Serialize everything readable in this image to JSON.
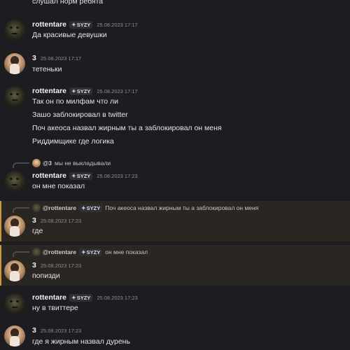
{
  "messages": [
    {
      "text": "слушал норм ребята"
    },
    {
      "author": "rottentare",
      "tag": "SYZY",
      "time": "25.08.2023 17:17",
      "lines": [
        "Да красивые девушки"
      ]
    },
    {
      "author": "3",
      "time": "25.08.2023 17:17",
      "lines": [
        "тетеньки"
      ]
    },
    {
      "author": "rottentare",
      "tag": "SYZY",
      "time": "25.08.2023 17:17",
      "lines": [
        "Так он по милфам что ли",
        "Зашо заблокировал в twitter",
        "Поч акеоса назвал жирным ты а заблокировал он меня",
        "Риддимщике где логика"
      ]
    },
    {
      "reply": {
        "author": "@3",
        "text": "мы не выкладывали"
      },
      "author": "rottentare",
      "tag": "SYZY",
      "time": "25.08.2023 17:23",
      "lines": [
        "он мне показал"
      ]
    },
    {
      "reply": {
        "author": "@rottentare",
        "tag": "SYZY",
        "text": "Поч акеоса назвал жирным ты а заблокировал он меня"
      },
      "author": "3",
      "time": "25.08.2023 17:23",
      "lines": [
        "где"
      ]
    },
    {
      "reply": {
        "author": "@rottentare",
        "tag": "SYZY",
        "text": "он мне показал"
      },
      "author": "3",
      "time": "25.08.2023 17:23",
      "lines": [
        "попизди"
      ]
    },
    {
      "author": "rottentare",
      "tag": "SYZY",
      "time": "25.08.2023 17:23",
      "lines": [
        "ну в твиттере"
      ]
    },
    {
      "author": "3",
      "time": "25.08.2023 17:23",
      "lines": [
        "где я жирным назвал дурень"
      ]
    }
  ],
  "colors": {
    "background": "#1c1c21",
    "highlight": "#2a2622",
    "highlight_border": "#c99a3c"
  },
  "icons": {
    "tag_icon": "sparkle-icon"
  }
}
